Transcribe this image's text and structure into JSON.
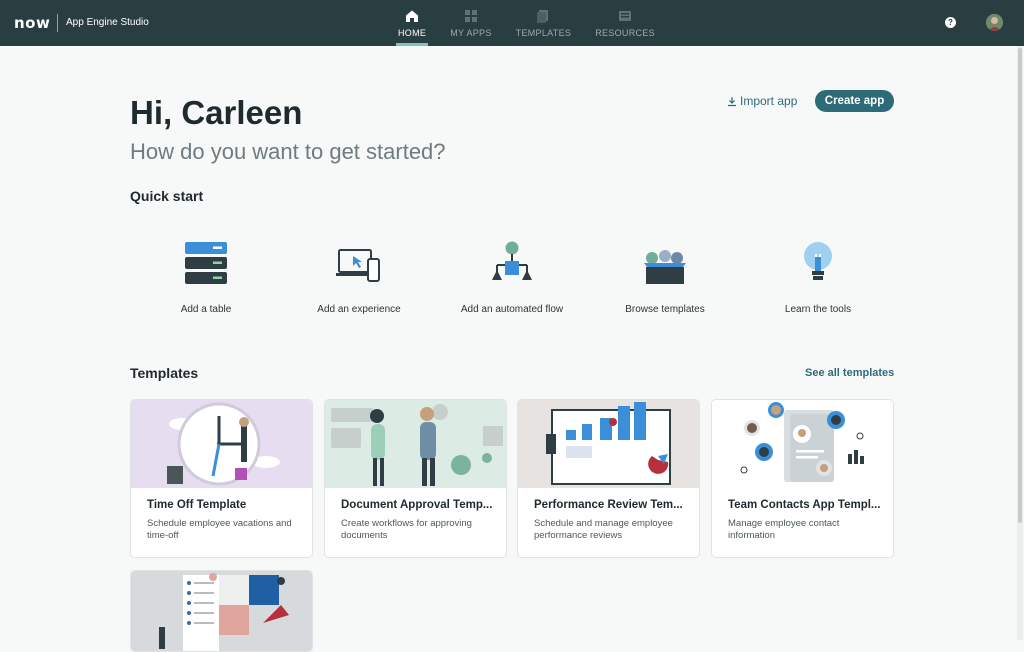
{
  "header": {
    "logo": "now",
    "app_name": "App Engine Studio",
    "nav": [
      {
        "label": "HOME",
        "icon": "home-icon"
      },
      {
        "label": "MY APPS",
        "icon": "grid-icon"
      },
      {
        "label": "TEMPLATES",
        "icon": "templates-icon"
      },
      {
        "label": "RESOURCES",
        "icon": "resources-icon"
      }
    ],
    "help": "?"
  },
  "main": {
    "greeting": "Hi, Carleen",
    "subtitle": "How do you want to get started?",
    "import_label": "Import app",
    "create_label": "Create app"
  },
  "quick_start": {
    "title": "Quick start",
    "items": [
      {
        "label": "Add a table",
        "icon": "database-table-icon"
      },
      {
        "label": "Add an experience",
        "icon": "devices-icon"
      },
      {
        "label": "Add an automated flow",
        "icon": "flow-icon"
      },
      {
        "label": "Browse templates",
        "icon": "template-box-icon"
      },
      {
        "label": "Learn the tools",
        "icon": "lightbulb-icon"
      }
    ]
  },
  "templates": {
    "title": "Templates",
    "see_all": "See all templates",
    "cards": [
      {
        "title": "Time Off Template",
        "desc": "Schedule employee vacations and time-off"
      },
      {
        "title": "Document Approval Temp...",
        "desc": "Create workflows for approving documents"
      },
      {
        "title": "Performance Review Tem...",
        "desc": "Schedule and manage employee performance reviews"
      },
      {
        "title": "Team Contacts App Templ...",
        "desc": "Manage employee contact information"
      },
      {
        "title": "",
        "desc": ""
      }
    ]
  },
  "colors": {
    "topbar": "#293e40",
    "accent": "#2e6b79",
    "page_bg": "#f7f8f8"
  }
}
